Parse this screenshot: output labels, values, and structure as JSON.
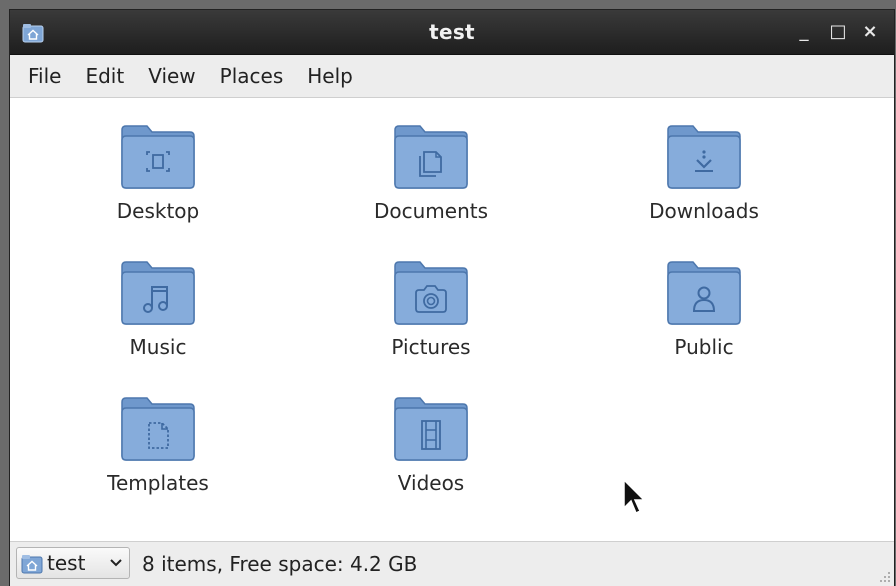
{
  "window": {
    "title": "test",
    "icon": "home-folder-icon",
    "controls": {
      "minimize": "_",
      "maximize": "□",
      "close": "×"
    }
  },
  "menubar": {
    "items": [
      {
        "label": "File"
      },
      {
        "label": "Edit"
      },
      {
        "label": "View"
      },
      {
        "label": "Places"
      },
      {
        "label": "Help"
      }
    ]
  },
  "folders": [
    {
      "label": "Desktop",
      "icon": "desktop-folder-icon"
    },
    {
      "label": "Documents",
      "icon": "documents-folder-icon"
    },
    {
      "label": "Downloads",
      "icon": "downloads-folder-icon"
    },
    {
      "label": "Music",
      "icon": "music-folder-icon"
    },
    {
      "label": "Pictures",
      "icon": "pictures-folder-icon"
    },
    {
      "label": "Public",
      "icon": "public-folder-icon"
    },
    {
      "label": "Templates",
      "icon": "templates-folder-icon"
    },
    {
      "label": "Videos",
      "icon": "videos-folder-icon"
    }
  ],
  "statusbar": {
    "location_label": "test",
    "status_text": "8 items, Free space: 4.2 GB"
  },
  "colors": {
    "folder_fill": "#7fa6d6",
    "folder_stroke": "#4d77ad",
    "titlebar": "#2b2b2b",
    "menubar": "#ededed"
  }
}
